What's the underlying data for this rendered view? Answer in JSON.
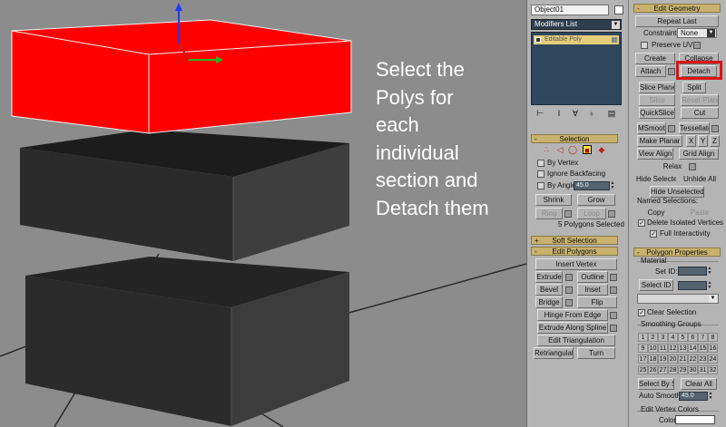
{
  "instruction": {
    "lines": [
      "Select the",
      "Polys for",
      "each",
      "individual",
      "section and",
      "Detach them"
    ]
  },
  "modifier_panel": {
    "object_name": "Object01",
    "modifier_list": "Modifiers List",
    "stack_item": "Editable Poly"
  },
  "selection_rollout": {
    "title": "Selection",
    "by_vertex": "By Vertex",
    "ignore_backfacing": "Ignore Backfacing",
    "by_angle": "By Angle:",
    "by_angle_value": "45.0",
    "shrink": "Shrink",
    "grow": "Grow",
    "ring": "Ring",
    "loop": "Loop",
    "status": "5 Polygons Selected"
  },
  "soft_selection": {
    "title": "Soft Selection"
  },
  "edit_polygons": {
    "title": "Edit Polygons",
    "insert_vertex": "Insert Vertex",
    "extrude": "Extrude",
    "outline": "Outline",
    "bevel": "Bevel",
    "inset": "Inset",
    "bridge": "Bridge",
    "flip": "Flip",
    "hinge_from_edge": "Hinge From Edge",
    "extrude_along_spline": "Extrude Along Spline",
    "edit_triangulation": "Edit Triangulation",
    "retriangulate": "Retriangulate",
    "turn": "Turn"
  },
  "edit_geometry": {
    "title": "Edit Geometry",
    "repeat_last": "Repeat Last",
    "constraints": "Constraints:",
    "constraints_value": "None",
    "preserve_uvs": "Preserve UVs",
    "create": "Create",
    "collapse": "Collapse",
    "attach": "Attach",
    "detach": "Detach",
    "slice_plane": "Slice Plane",
    "split": "Split",
    "slice": "Slice",
    "reset_plane": "Reset Plane",
    "quickslice": "QuickSlice",
    "cut": "Cut",
    "msmooth": "MSmooth",
    "tessellate": "Tessellate",
    "make_planar": "Make Planar",
    "x": "X",
    "y": "Y",
    "z": "Z",
    "view_align": "View Align",
    "grid_align": "Grid Align",
    "relax": "Relax",
    "hide_selected": "Hide Selected",
    "unhide_all": "Unhide All",
    "hide_unselected": "Hide Unselected",
    "named_selections": "Named Selections:",
    "copy": "Copy",
    "paste": "Paste",
    "delete_isolated": "Delete Isolated Vertices",
    "full_interactivity": "Full Interactivity"
  },
  "polygon_properties": {
    "title": "Polygon Properties",
    "material": "Material",
    "set_id": "Set ID:",
    "select_id": "Select ID",
    "clear_selection": "Clear Selection",
    "smoothing_groups": "Smoothing Groups",
    "groups": [
      "1",
      "2",
      "3",
      "4",
      "5",
      "6",
      "7",
      "8",
      "9",
      "10",
      "11",
      "12",
      "13",
      "14",
      "15",
      "16",
      "17",
      "18",
      "19",
      "20",
      "21",
      "22",
      "23",
      "24",
      "25",
      "26",
      "27",
      "28",
      "29",
      "30",
      "31",
      "32"
    ],
    "select_by_sg": "Select By SG",
    "clear_all": "Clear All",
    "auto_smooth": "Auto Smooth",
    "auto_smooth_value": "45.0",
    "edit_vertex_colors": "Edit Vertex Colors",
    "color": "Color:"
  },
  "colors": {
    "selected_faces": "#ff0000",
    "rollout_header": "#c8b26e",
    "viewport_bg": "#8c8c8c",
    "highlight_box": "#e01212"
  }
}
